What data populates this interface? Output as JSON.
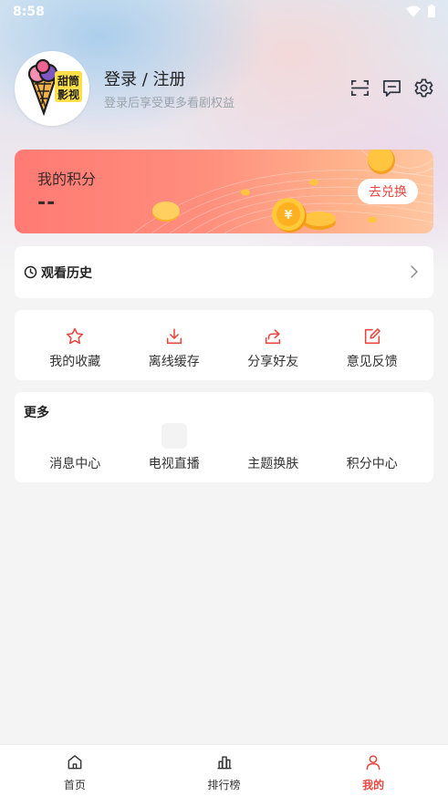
{
  "status_bar": {
    "time": "8:58",
    "icons": [
      "wifi-icon",
      "battery-icon"
    ]
  },
  "profile": {
    "logo_text": "甜筒影视",
    "title": "登录 / 注册",
    "subtitle": "登录后享受更多看剧权益",
    "actions": [
      "scan-icon",
      "message-icon",
      "gear-icon"
    ]
  },
  "points": {
    "title": "我的积分",
    "value": "--",
    "redeem_label": "去兑换"
  },
  "history": {
    "title": "观看历史",
    "icon": "clock-icon"
  },
  "functions": [
    {
      "label": "我的收藏",
      "icon": "star-icon"
    },
    {
      "label": "离线缓存",
      "icon": "download-icon"
    },
    {
      "label": "分享好友",
      "icon": "share-icon"
    },
    {
      "label": "意见反馈",
      "icon": "edit-icon"
    }
  ],
  "more": {
    "title": "更多",
    "items": [
      {
        "label": "消息中心"
      },
      {
        "label": "电视直播"
      },
      {
        "label": "主题换肤"
      },
      {
        "label": "积分中心"
      }
    ]
  },
  "tabbar": {
    "items": [
      {
        "label": "首页",
        "icon": "home-icon"
      },
      {
        "label": "排行榜",
        "icon": "ranking-icon"
      },
      {
        "label": "我的",
        "icon": "user-icon",
        "active": true
      }
    ]
  },
  "colors": {
    "accent": "#e8473f",
    "icon_red": "#e8473f",
    "card_gradient_start": "#ff7a73",
    "card_gradient_end": "#ffc7a2"
  }
}
